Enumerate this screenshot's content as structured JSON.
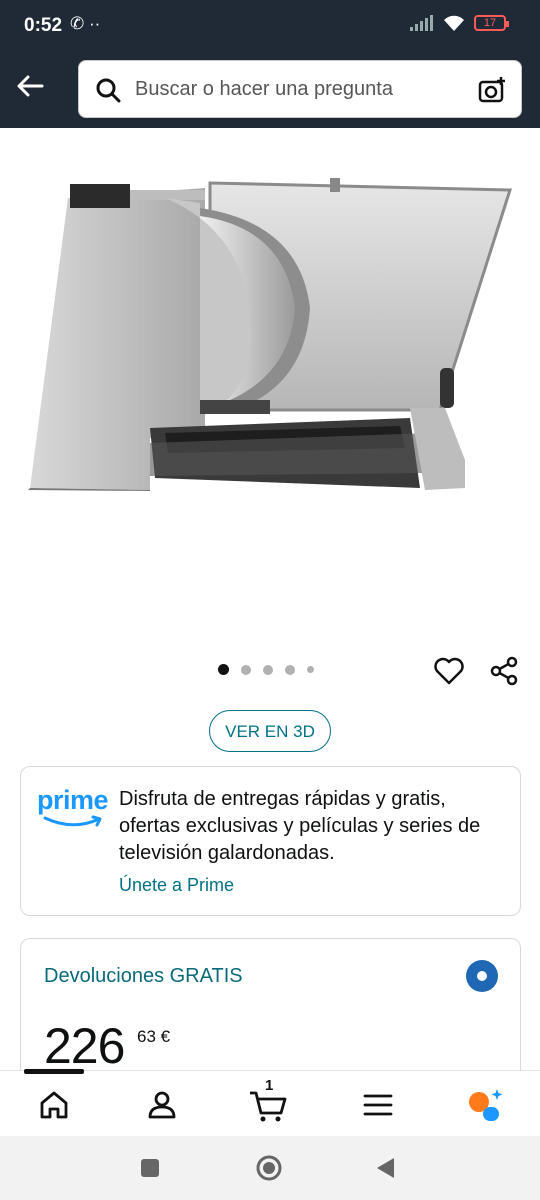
{
  "status_bar": {
    "time": "0:52",
    "left_icons": "✆ ··",
    "battery": "17"
  },
  "header": {
    "search_placeholder": "Buscar o hacer una pregunta",
    "icons": [
      "back-arrow-icon",
      "search-icon",
      "camera-search-icon"
    ]
  },
  "gallery": {
    "image_count": 5,
    "active_index": 0
  },
  "actions": {
    "view_3d_label": "VER EN 3D"
  },
  "prime_card": {
    "logo_text": "prime",
    "text": "Disfruta de entregas rápidas y gratis, ofertas exclusivas y películas y series de televisión galardonadas.",
    "link_label": "Únete a Prime"
  },
  "returns_card": {
    "title": "Devoluciones GRATIS",
    "price_whole": "226",
    "price_fraction": "63 €"
  },
  "bottom_nav": {
    "cart_count": "1",
    "items": [
      "home-icon",
      "account-icon",
      "cart-icon",
      "menu-icon",
      "rufus-icon"
    ]
  },
  "colors": {
    "header_bg": "#1f2a36",
    "link": "#007185",
    "prime_blue": "#1a98ff",
    "radio": "#2067b6"
  }
}
